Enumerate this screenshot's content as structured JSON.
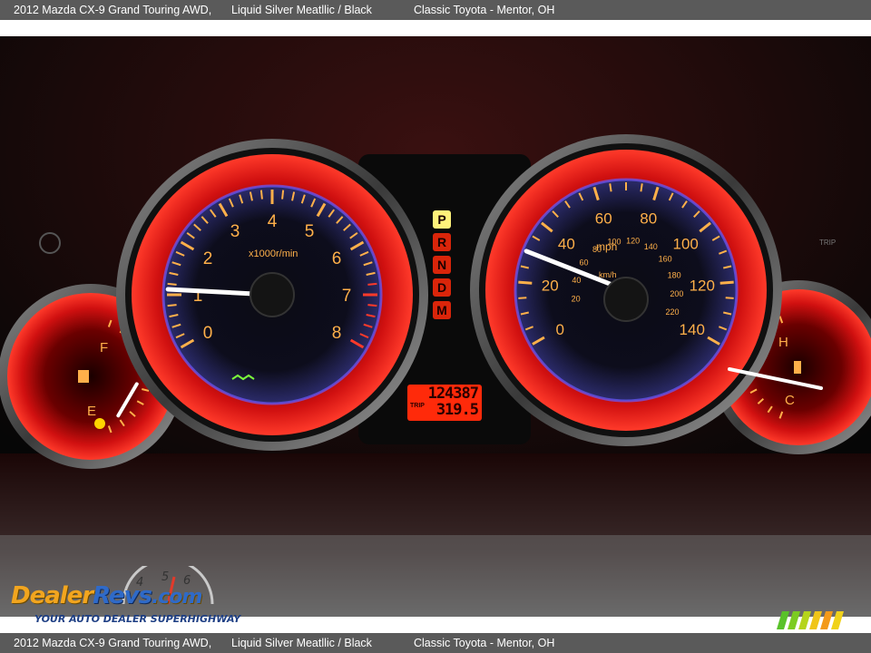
{
  "caption": {
    "vehicle": "2012 Mazda CX-9 Grand Touring AWD,",
    "color": "Liquid Silver Meatllic / Black",
    "dealer": "Classic Toyota - Mentor, OH"
  },
  "tachometer": {
    "labels": [
      "0",
      "1",
      "2",
      "3",
      "4",
      "5",
      "6",
      "7",
      "8"
    ],
    "unit": "x1000r/min",
    "needle_rpm": 1.1
  },
  "speedometer": {
    "mph_labels": [
      "0",
      "20",
      "40",
      "60",
      "80",
      "100",
      "120",
      "140"
    ],
    "mph_unit": "mph",
    "kmh_labels": [
      "20",
      "40",
      "60",
      "80",
      "100",
      "120",
      "140",
      "160",
      "180",
      "200",
      "220"
    ],
    "kmh_unit": "km/h",
    "needle_mph": 30
  },
  "gear_indicator": {
    "gears": [
      "P",
      "R",
      "N",
      "D",
      "M"
    ],
    "active": "P"
  },
  "odometer": {
    "total": "124387",
    "trip_label": "TRIP",
    "trip": "319.5"
  },
  "fuel_gauge": {
    "full_label": "F",
    "empty_label": "E",
    "level_fraction": 0.12
  },
  "temp_gauge": {
    "hot_label": "H",
    "cold_label": "C",
    "level_fraction": 0.5
  },
  "dealer_logo": {
    "name_part1": "Dealer",
    "name_part2": "Revs",
    "name_part3": ".com",
    "tagline": "YOUR AUTO DEALER SUPERHIGHWAY",
    "dial_digits": [
      "4",
      "5",
      "6"
    ]
  },
  "colors": {
    "caption_bar": "#5a5a5a",
    "gauge_glow": "#ff1e1e",
    "gauge_text": "#ffb04a",
    "needle": "#ffffff",
    "logo_orange": "#f2a51f",
    "logo_blue": "#2f6ac8"
  }
}
